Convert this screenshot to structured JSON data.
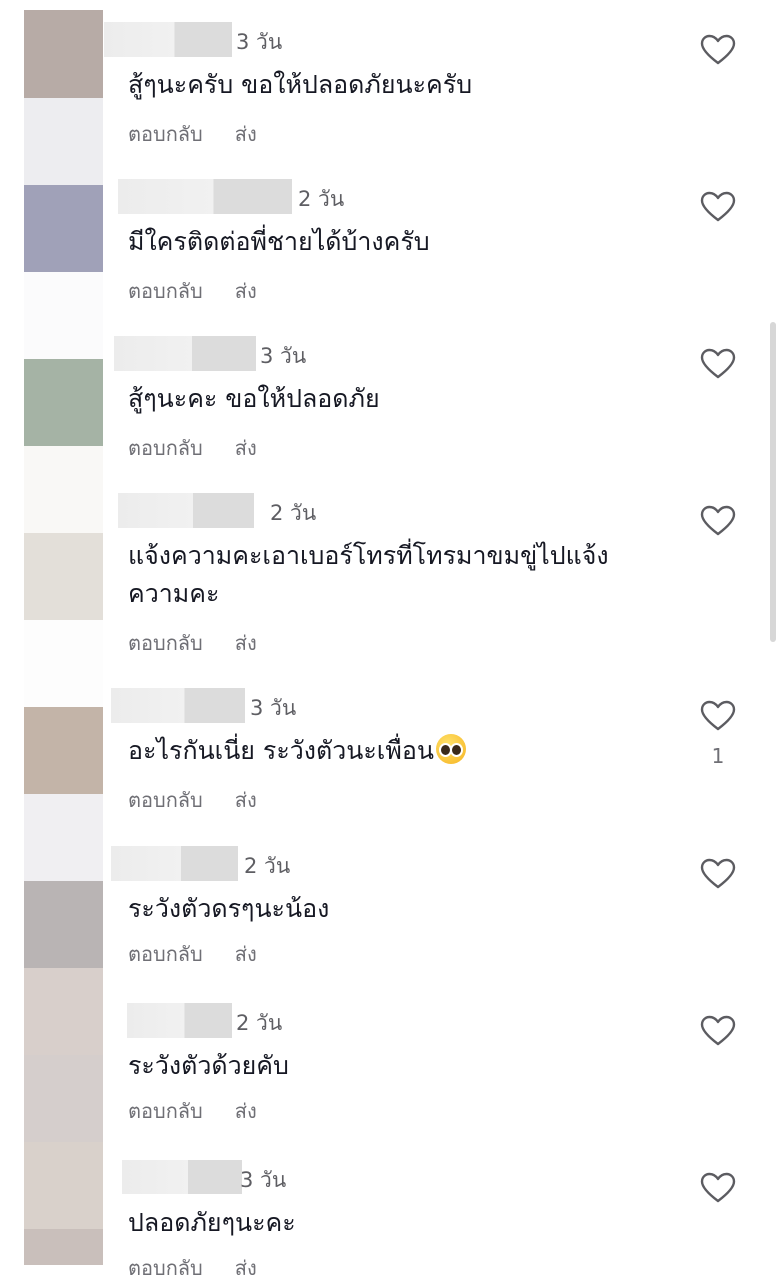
{
  "comments": [
    {
      "time": "3 วัน",
      "text": "สู้ๆนะครับ ขอให้ปลอดภัยนะครับ",
      "reply": "ตอบกลับ",
      "send": "ส่ง",
      "likes": ""
    },
    {
      "time": "2 วัน",
      "text": "มีใครติดต่อพี่ชายได้บ้างครับ",
      "reply": "ตอบกลับ",
      "send": "ส่ง",
      "likes": ""
    },
    {
      "time": "3 วัน",
      "text": "สู้ๆนะคะ ขอให้ปลอดภัย",
      "reply": "ตอบกลับ",
      "send": "ส่ง",
      "likes": ""
    },
    {
      "time": "2 วัน",
      "text": "แจ้งความคะเอาเบอร์โทรที่โทรมาขมขู่ไปแจ้งความคะ",
      "reply": "ตอบกลับ",
      "send": "ส่ง",
      "likes": ""
    },
    {
      "time": "3 วัน",
      "text": "อะไรกันเนี่ย ระวังตัวนะเพื่อน",
      "reply": "ตอบกลับ",
      "send": "ส่ง",
      "likes": "1",
      "emoji": "pleading-face-emoji"
    },
    {
      "time": "2 วัน",
      "text": "ระวังตัวดรๆนะน้อง",
      "reply": "ตอบกลับ",
      "send": "ส่ง",
      "likes": ""
    },
    {
      "time": "2 วัน",
      "text": "ระวังตัวด้วยคับ",
      "reply": "ตอบกลับ",
      "send": "ส่ง",
      "likes": ""
    },
    {
      "time": "3 วัน",
      "text": "ปลอดภัยๆนะคะ",
      "reply": "ตอบกลับ",
      "send": "ส่ง",
      "likes": ""
    }
  ],
  "icons": {
    "like": "heart-outline-icon"
  },
  "colors": {
    "text": "#161823",
    "muted": "#6f6f75",
    "icon": "#5c5c61"
  }
}
